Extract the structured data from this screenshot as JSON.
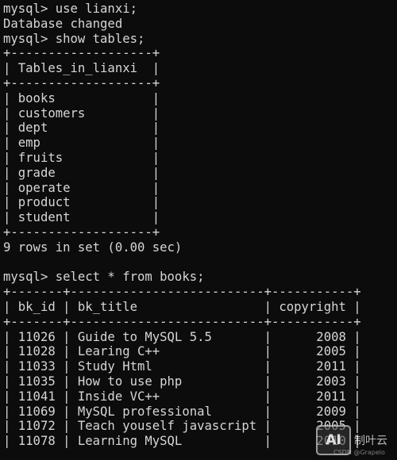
{
  "session1": {
    "cmd_use": "mysql> use lianxi;",
    "db_changed": "Database changed",
    "cmd_show": "mysql> show tables;",
    "border": "+-------------------+",
    "header": "| Tables_in_lianxi  |",
    "rows": [
      "| books             |",
      "| customers         |",
      "| dept              |",
      "| emp               |",
      "| fruits            |",
      "| grade             |",
      "| operate           |",
      "| product           |",
      "| student           |"
    ],
    "summary": "9 rows in set (0.00 sec)"
  },
  "session2": {
    "cmd_select": "mysql> select * from books;",
    "border": "+-------+--------------------------+-----------+",
    "header": "| bk_id | bk_title                 | copyright |",
    "rows": [
      "| 11026 | Guide to MySQL 5.5       |      2008 |",
      "| 11028 | Learing C++              |      2005 |",
      "| 11033 | Study Html               |      2011 |",
      "| 11035 | How to use php           |      2003 |",
      "| 11041 | Inside VC++              |      2011 |",
      "| 11069 | MySQL professional       |      2009 |",
      "| 11072 | Teach youself javascript |      2005 |",
      "| 11078 | Learning MySQL           |      2010 |"
    ]
  },
  "watermark": {
    "logo_text": "AI",
    "brand": "制叶云",
    "credit": "CSDN @Grapelo"
  },
  "colors": {
    "background": "#0c0c0c",
    "foreground": "#d6d6d6"
  }
}
